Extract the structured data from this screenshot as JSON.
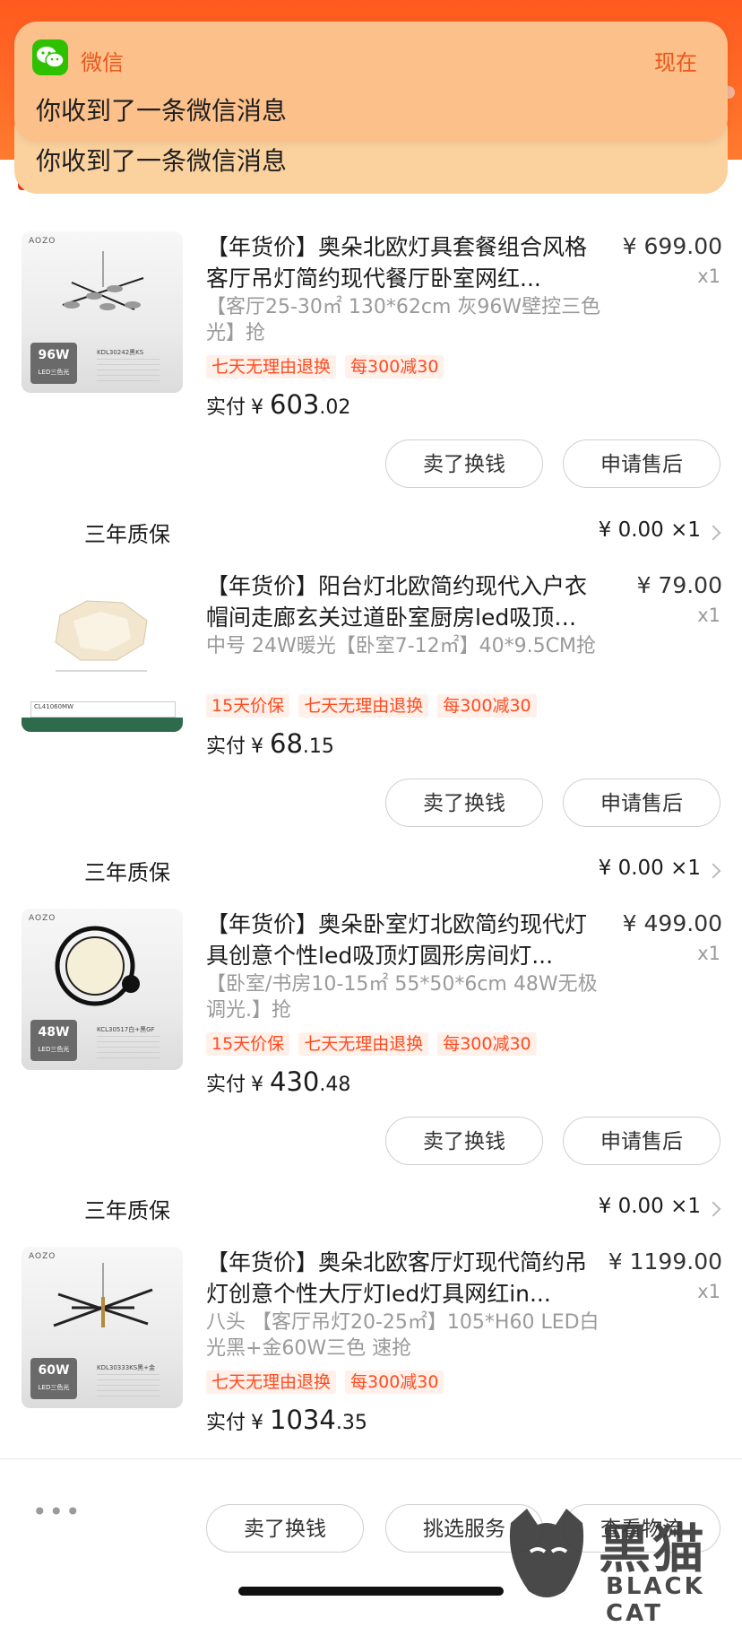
{
  "notification": {
    "app": "微信",
    "time": "现在",
    "message": "你收到了一条微信消息",
    "message_behind": "你收到了一条微信消息"
  },
  "orders": [
    {
      "title": "【年货价】奥朵北欧灯具套餐组合风格客厅吊灯简约现代餐厅卧室网红...",
      "price": "¥ 699.00",
      "qty": "x1",
      "spec": "【客厅25-30㎡ 130*62cm 灰96W壁控三色光】抢",
      "tags": [
        "七天无理由退换",
        "每300减30"
      ],
      "paid_label": "实付",
      "paid_yen": "¥",
      "paid_int": "603",
      "paid_dec": ".02",
      "image": {
        "brand": "AOZO",
        "watt": "96W",
        "badge": "LED三色光",
        "sku": "KDL30242黑KS"
      },
      "buttons": [
        "卖了换钱",
        "申请售后"
      ]
    },
    {
      "title": "【年货价】阳台灯北欧简约现代入户衣帽间走廊玄关过道卧室厨房led吸顶灯具",
      "price": "¥ 79.00",
      "qty": "x1",
      "spec": "中号 24W暖光【卧室7-12㎡】40*9.5CM抢",
      "tags": [
        "15天价保",
        "七天无理由退换",
        "每300减30"
      ],
      "paid_label": "实付",
      "paid_yen": "¥",
      "paid_int": "68",
      "paid_dec": ".15",
      "image": {
        "brand": "",
        "watt": "",
        "badge": "",
        "sku": "CL41060MW"
      },
      "buttons": [
        "卖了换钱",
        "申请售后"
      ]
    },
    {
      "title": "【年货价】奥朵卧室灯北欧简约现代灯具创意个性led吸顶灯圆形房间灯...",
      "price": "¥ 499.00",
      "qty": "x1",
      "spec": "【卧室/书房10-15㎡ 55*50*6cm 48W无极调光.】抢",
      "tags": [
        "15天价保",
        "七天无理由退换",
        "每300减30"
      ],
      "paid_label": "实付",
      "paid_yen": "¥",
      "paid_int": "430",
      "paid_dec": ".48",
      "image": {
        "brand": "AOZO",
        "watt": "48W",
        "badge": "LED三色光",
        "sku": "KCL30517白+黑GF"
      },
      "buttons": [
        "卖了换钱",
        "申请售后"
      ]
    },
    {
      "title": "【年货价】奥朵北欧客厅灯现代简约吊灯创意个性大厅灯led灯具网红in...",
      "price": "¥ 1199.00",
      "qty": "x1",
      "spec": "八头 【客厅吊灯20-25㎡】105*H60 LED白光黑+金60W三色 速抢",
      "tags": [
        "七天无理由退换",
        "每300减30"
      ],
      "paid_label": "实付",
      "paid_yen": "¥",
      "paid_int": "1034",
      "paid_dec": ".35",
      "image": {
        "brand": "AOZO",
        "watt": "60W",
        "badge": "LED三色光",
        "sku": "KDL30333KS黑+金"
      },
      "buttons": [
        "卖了换钱",
        "申请售后"
      ]
    }
  ],
  "warranty": {
    "label": "三年质保",
    "price": "¥ 0.00 ×1"
  },
  "footer": {
    "more": "•••",
    "buttons": [
      "卖了换钱",
      "挑选服务",
      "查看物流"
    ]
  },
  "watermark": {
    "cn": "黑猫",
    "en": "BLACK CAT"
  }
}
